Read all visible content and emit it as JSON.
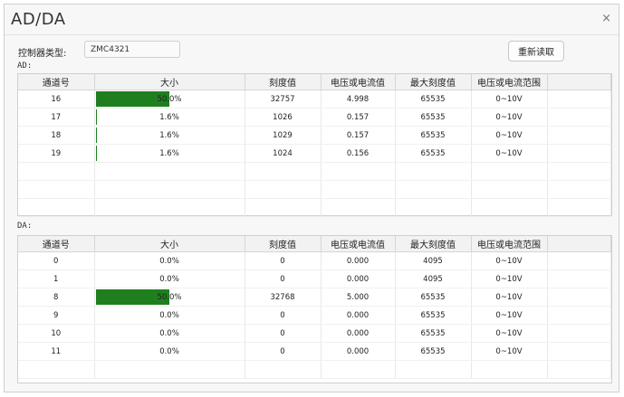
{
  "window": {
    "title": "AD/DA",
    "close_glyph": "×"
  },
  "controller": {
    "label": "控制器类型:",
    "value": "ZMC4321"
  },
  "reread_button": "重新读取",
  "columns": [
    "通道号",
    "大小",
    "刻度值",
    "电压或电流值",
    "最大刻度值",
    "电压或电流范围",
    ""
  ],
  "ad": {
    "label": "AD:",
    "rows": [
      {
        "channel": "16",
        "size": "50.0%",
        "level": 0.5,
        "scale": "32757",
        "value": "4.998",
        "max": "65535",
        "range": "0~10V"
      },
      {
        "channel": "17",
        "size": "1.6%",
        "level": 0.016,
        "scale": "1026",
        "value": "0.157",
        "max": "65535",
        "range": "0~10V"
      },
      {
        "channel": "18",
        "size": "1.6%",
        "level": 0.016,
        "scale": "1029",
        "value": "0.157",
        "max": "65535",
        "range": "0~10V"
      },
      {
        "channel": "19",
        "size": "1.6%",
        "level": 0.016,
        "scale": "1024",
        "value": "0.156",
        "max": "65535",
        "range": "0~10V"
      }
    ]
  },
  "da": {
    "label": "DA:",
    "rows": [
      {
        "channel": "0",
        "size": "0.0%",
        "level": 0,
        "scale": "0",
        "value": "0.000",
        "max": "4095",
        "range": "0~10V"
      },
      {
        "channel": "1",
        "size": "0.0%",
        "level": 0,
        "scale": "0",
        "value": "0.000",
        "max": "4095",
        "range": "0~10V"
      },
      {
        "channel": "8",
        "size": "50.0%",
        "level": 0.5,
        "scale": "32768",
        "value": "5.000",
        "max": "65535",
        "range": "0~10V"
      },
      {
        "channel": "9",
        "size": "0.0%",
        "level": 0,
        "scale": "0",
        "value": "0.000",
        "max": "65535",
        "range": "0~10V"
      },
      {
        "channel": "10",
        "size": "0.0%",
        "level": 0,
        "scale": "0",
        "value": "0.000",
        "max": "65535",
        "range": "0~10V"
      },
      {
        "channel": "11",
        "size": "0.0%",
        "level": 0,
        "scale": "0",
        "value": "0.000",
        "max": "65535",
        "range": "0~10V"
      }
    ]
  },
  "colors": {
    "bar": "#1f7f1f",
    "border": "#cfcfcf",
    "header_bg": "#f2f2f2"
  }
}
